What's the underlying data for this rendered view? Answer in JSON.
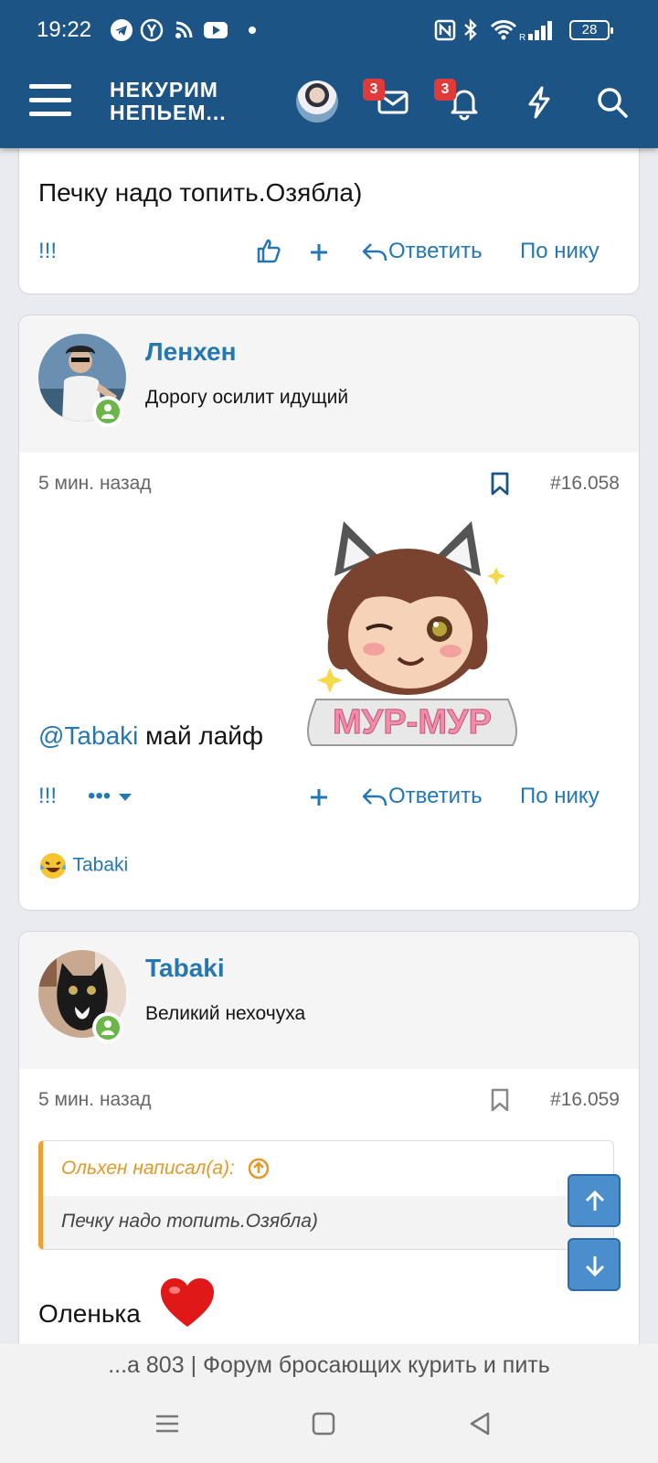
{
  "status_bar": {
    "time": "19:22",
    "battery": "28",
    "icons": [
      "telegram-icon",
      "yandex-icon",
      "rss-icon",
      "youtube-icon",
      "dot-icon",
      "nfc-icon",
      "bluetooth-icon",
      "wifi-icon",
      "signal-icon"
    ]
  },
  "header": {
    "logo_line1": "НЕКУРИМ",
    "logo_line2": "НЕПЬЕМ...",
    "messages_badge": "3",
    "alerts_badge": "3",
    "icons": [
      "menu-icon",
      "mail-icon",
      "bell-icon",
      "lightning-icon",
      "search-icon"
    ]
  },
  "posts": [
    {
      "text": "Печку надо топить.Озябла)",
      "actions": {
        "marks": "!!!",
        "reply": "Ответить",
        "by_nick": "По нику"
      }
    },
    {
      "username": "Ленхен",
      "user_title": "Дорогу осилит идущий",
      "time": "5 мин. назад",
      "post_number": "#16.058",
      "mention": "@Tabaki",
      "text": "май лайф",
      "sticker_text": "МУР-МУР",
      "actions": {
        "marks": "!!!",
        "more": "•••",
        "reply": "Ответить",
        "by_nick": "По нику"
      },
      "reaction_user": "Tabaki"
    },
    {
      "username": "Tabaki",
      "user_title": "Великий нехочуха",
      "time": "5 мин. назад",
      "post_number": "#16.059",
      "quote_author": "Ольхен написал(а):",
      "quote_text": "Печку надо топить.Озябла)",
      "text": "Оленька"
    }
  ],
  "url_bar": "...а 803 | Форум бросающих курить и пить",
  "colors": {
    "header": "#1d5486",
    "link": "#2577b1",
    "online": "#6bb54a",
    "quote_accent": "#f0a030",
    "scroll_button": "#4a8ecc"
  }
}
